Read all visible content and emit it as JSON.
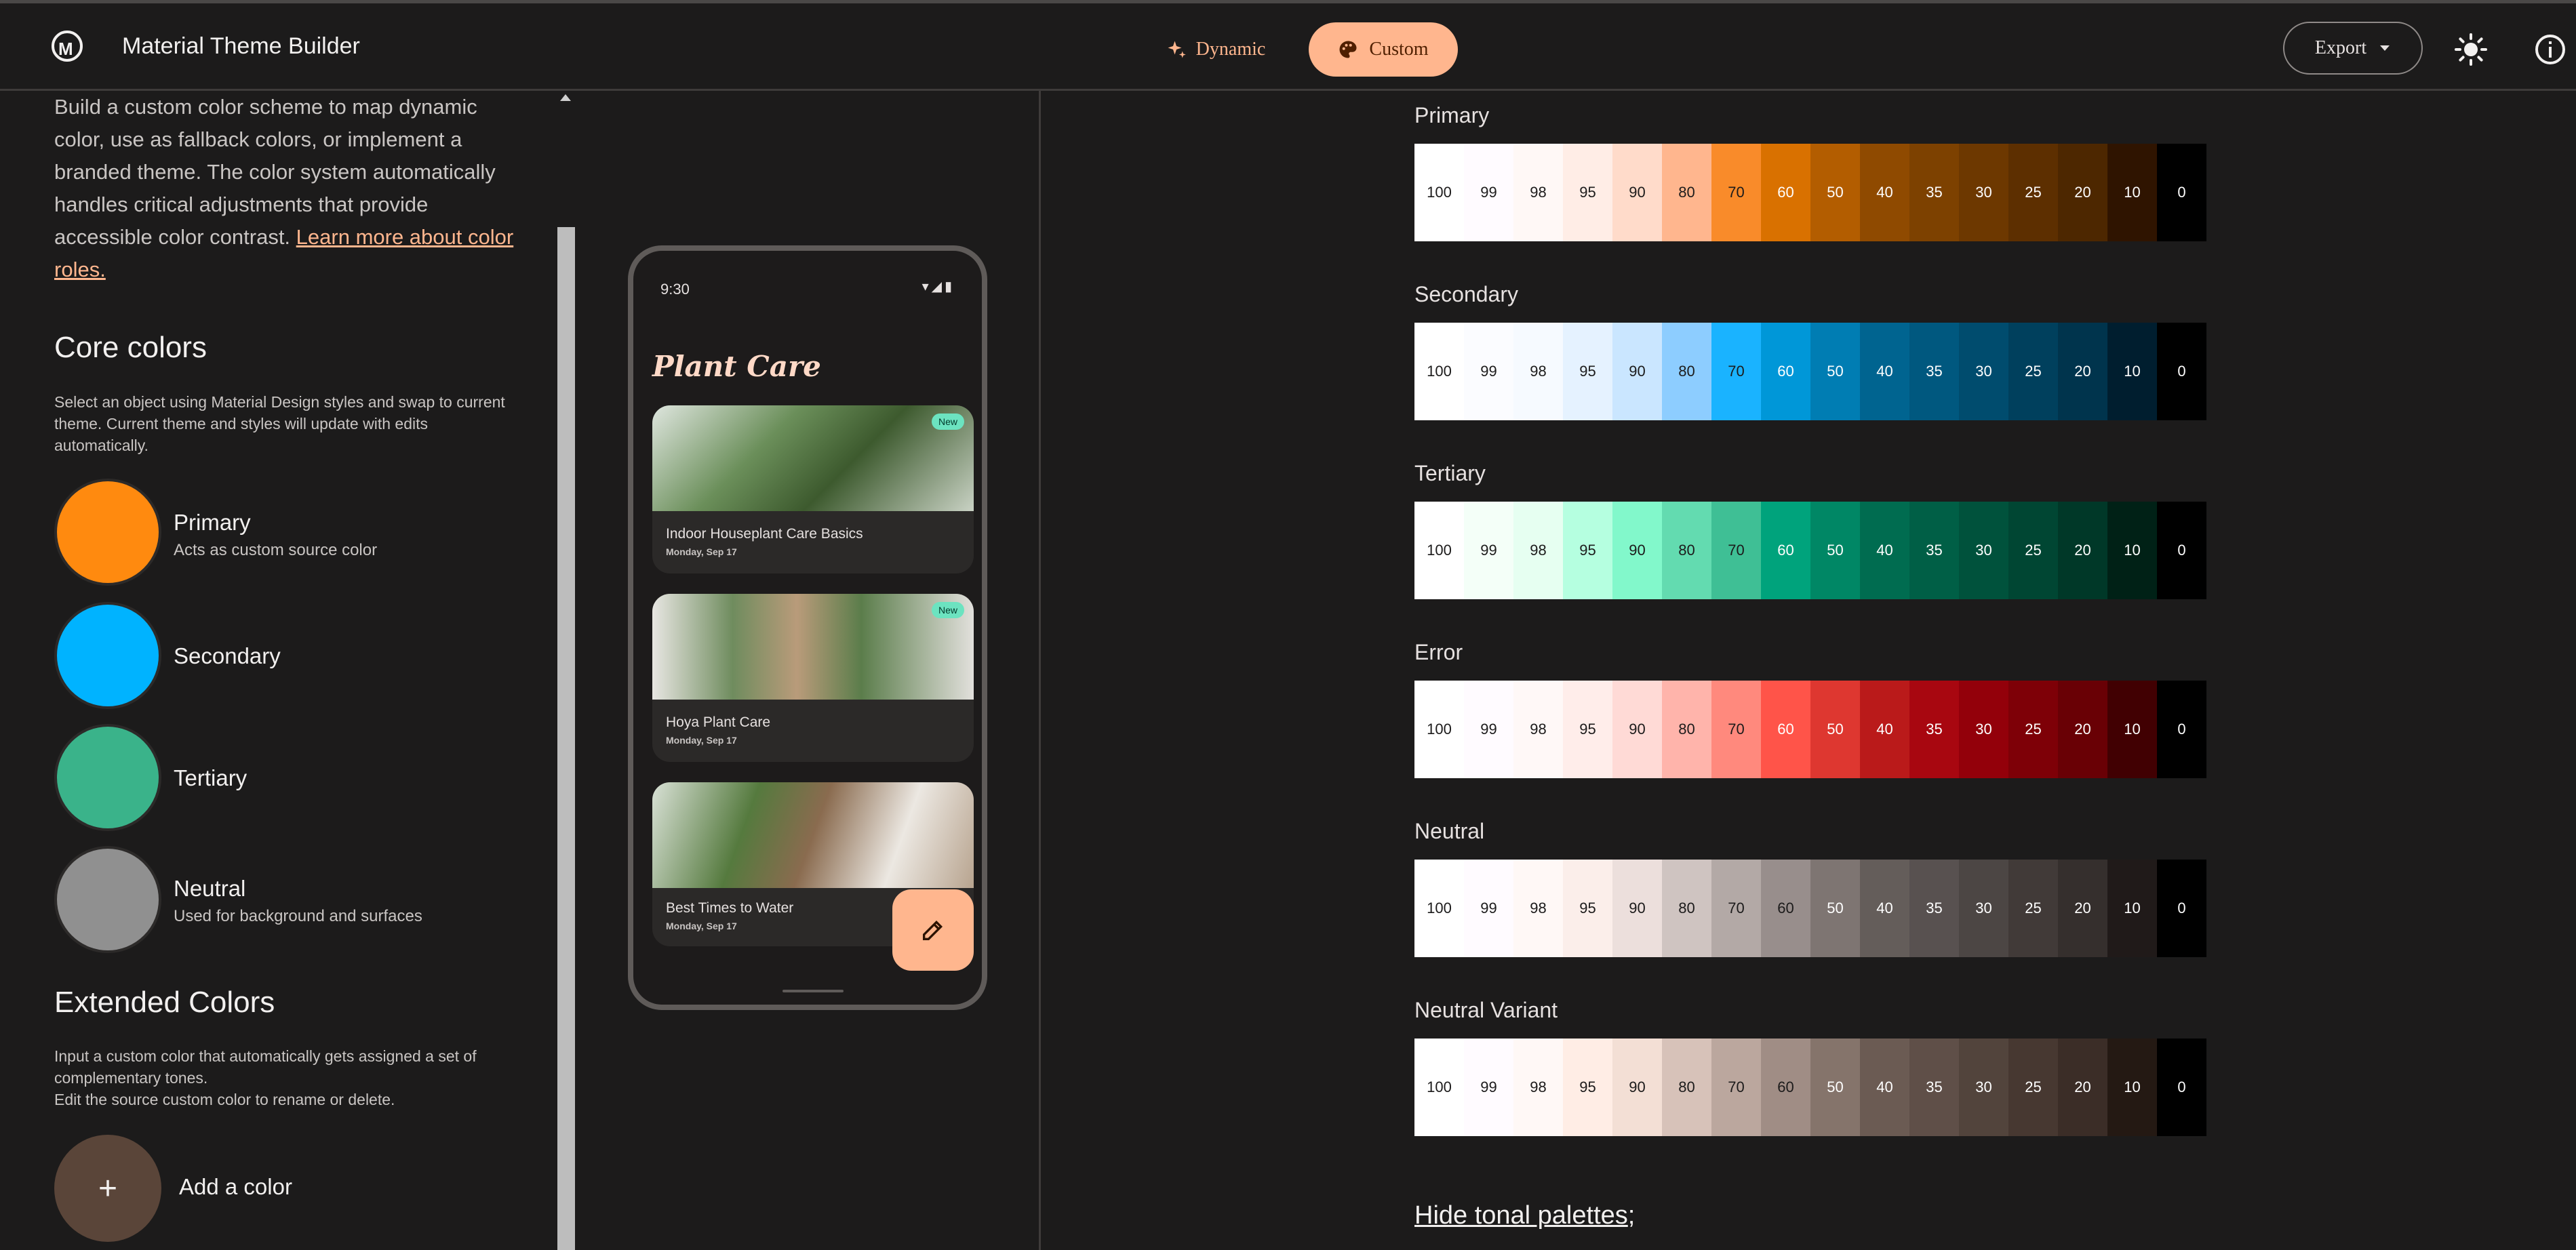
{
  "header": {
    "app_title": "Material Theme Builder",
    "dynamic_label": "Dynamic",
    "custom_label": "Custom",
    "export_label": "Export",
    "accent": "#ffb68e"
  },
  "left": {
    "intro_text": "Build a custom color scheme to map dynamic color, use as fallback colors, or implement a branded theme. The color system automatically handles critical adjustments that provide accessible color contrast.",
    "intro_link": "Learn more about color roles.",
    "core_title": "Core colors",
    "core_desc": "Select an object using Material Design styles and swap to current theme. Current theme and styles will update with edits automatically.",
    "core_colors": [
      {
        "name": "Primary",
        "sub": "Acts as custom source color",
        "color": "#ff8a0f"
      },
      {
        "name": "Secondary",
        "sub": "",
        "color": "#00b3ff"
      },
      {
        "name": "Tertiary",
        "sub": "",
        "color": "#3ab38a"
      },
      {
        "name": "Neutral",
        "sub": "Used for background and surfaces",
        "color": "#909090"
      }
    ],
    "extended_title": "Extended Colors",
    "extended_desc_1": "Input a custom color that automatically gets assigned a set of complementary tones.",
    "extended_desc_2": "Edit the source custom color to rename or delete.",
    "add_icon": "+",
    "add_label": "Add a color"
  },
  "phone": {
    "time": "9:30",
    "app_title": "Plant Care",
    "cards": [
      {
        "title": "Indoor Houseplant Care Basics",
        "date": "Monday, Sep 17",
        "badge": "New"
      },
      {
        "title": "Hoya Plant Care",
        "date": "Monday, Sep 17",
        "badge": "New"
      },
      {
        "title": "Best Times to Water",
        "date": "Monday, Sep 17",
        "badge": ""
      }
    ]
  },
  "palettes": {
    "tones": [
      "100",
      "99",
      "98",
      "95",
      "90",
      "80",
      "70",
      "60",
      "50",
      "40",
      "35",
      "30",
      "25",
      "20",
      "10",
      "0"
    ],
    "rows": [
      {
        "name": "Primary",
        "colors": [
          "#ffffff",
          "#fffbff",
          "#fff8f6",
          "#ffede6",
          "#ffdbca",
          "#ffb68e",
          "#f98b2a",
          "#d97100",
          "#b35d00",
          "#8f4a00",
          "#7d4100",
          "#6d3800",
          "#5d2f00",
          "#4d2700",
          "#2f1400",
          "#000000"
        ]
      },
      {
        "name": "Secondary",
        "colors": [
          "#ffffff",
          "#fbfcff",
          "#f6faff",
          "#e5f2ff",
          "#cae6ff",
          "#8dcdff",
          "#1ab3ff",
          "#0097d8",
          "#007db3",
          "#006490",
          "#00587f",
          "#004c6e",
          "#00405d",
          "#00344d",
          "#001e2f",
          "#000000"
        ]
      },
      {
        "name": "Tertiary",
        "colors": [
          "#ffffff",
          "#f4fff8",
          "#e6fff1",
          "#b5ffe0",
          "#82f8cb",
          "#63dbb0",
          "#3fbf95",
          "#00a37c",
          "#008765",
          "#006c50",
          "#005f46",
          "#00523c",
          "#004633",
          "#003828",
          "#002116",
          "#000000"
        ]
      },
      {
        "name": "Error",
        "colors": [
          "#ffffff",
          "#fffbff",
          "#fff8f7",
          "#ffedea",
          "#ffdad6",
          "#ffb4ab",
          "#ff897d",
          "#ff5449",
          "#de3730",
          "#ba1a1a",
          "#a80710",
          "#93000a",
          "#7e0007",
          "#690005",
          "#410002",
          "#000000"
        ]
      },
      {
        "name": "Neutral",
        "colors": [
          "#ffffff",
          "#fffbff",
          "#fff8f6",
          "#fbeeea",
          "#ecdfdc",
          "#cfc4c1",
          "#b3a9a6",
          "#988e8c",
          "#7e7572",
          "#645d5a",
          "#585150",
          "#4c4644",
          "#413a38",
          "#352f2d",
          "#201a19",
          "#000000"
        ]
      },
      {
        "name": "Neutral Variant",
        "colors": [
          "#ffffff",
          "#fffbff",
          "#fff8f6",
          "#ffede5",
          "#f3dfd5",
          "#d7c2b9",
          "#bba79e",
          "#a08d85",
          "#85746b",
          "#6b5b53",
          "#5f4f48",
          "#52443c",
          "#473831",
          "#3b2d27",
          "#241913",
          "#000000"
        ]
      }
    ],
    "hide_label": "Hide tonal palettes",
    "hide_suffix": ";"
  }
}
